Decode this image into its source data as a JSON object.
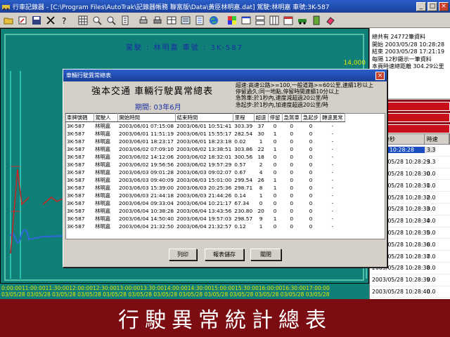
{
  "window": {
    "title": "行車記錄器 - [C:\\Program Files\\AutoTrak\\記錄器帳務 聯富版\\Data\\黃臣林明嘉.dat]   駕駛:林明嘉   車號:3K-587",
    "buttons": [
      "_",
      "□",
      "×"
    ]
  },
  "chart": {
    "header": "駕駛 : 林明嘉     車號 : 3K-587",
    "y_top_label": "14,000",
    "time_rows": [
      "0:00:0011:00:0011:30:0012:00:0012:30:0013:00:0013:30:0014:00:0014:30:0015:00:0015:30:0016:00:0016:30:0017:00:00",
      "03/05/28 03/05/28 03/05/28 03/05/28 03/05/28 03/05/28 03/05/28 03/05/28 03/05/28 03/05/28 03/05/28 03/05/28 03/05/28"
    ]
  },
  "right_panel": {
    "info": [
      "總共有 24772筆資料",
      "開始 2003/05/28 10:28:28",
      "結束 2003/05/28 17:21:19",
      "每隔 12秒顯示一筆資料",
      "本頁時速總距離    304.29公里"
    ],
    "red_buttons": [
      "",
      "速",
      "速"
    ],
    "table_headers": [
      "日時分秒",
      "時速"
    ],
    "rows": [
      {
        "time": "05/28 10:28:28",
        "value": "3.3",
        "selected": true
      },
      {
        "time": "2003/05/28 10:28:29",
        "value": "3.3"
      },
      {
        "time": "2003/05/28 10:28:30",
        "value": "0.0"
      },
      {
        "time": "2003/05/28 10:28:31",
        "value": "0.0"
      },
      {
        "time": "2003/05/28 10:28:32",
        "value": "0.0"
      },
      {
        "time": "2003/05/28 10:28:33",
        "value": "0.0"
      },
      {
        "time": "2003/05/28 10:28:34",
        "value": "0.0"
      },
      {
        "time": "2003/05/28 10:28:35",
        "value": "0.0"
      },
      {
        "time": "2003/05/28 10:28:36",
        "value": "0.0"
      },
      {
        "time": "2003/05/28 10:28:37",
        "value": "0.0"
      },
      {
        "time": "2003/05/28 10:28:38",
        "value": "0.0"
      },
      {
        "time": "2003/05/28 10:28:39",
        "value": "0.0"
      },
      {
        "time": "2003/05/28 10:28:40",
        "value": "0.0"
      },
      {
        "time": "2003/05/28 10:28:41",
        "value": "0.0"
      }
    ]
  },
  "dialog": {
    "title": "車輛行駛異常總表",
    "company": "強本交通  車輛行駛異常總表",
    "period": "期間: 03年6月",
    "rules": [
      "超速:高速公路>=100,一般道路>=60公里,連續1秒以上",
      "停留過久:同一地點,停留時間連續10分以上",
      "急煞車:於1秒內,速度減超過20公里/時",
      "急起步:於1秒內,加速度超過20公里/時"
    ],
    "columns": [
      "車牌號碼",
      "駕駛人",
      "開始時間",
      "結束時間",
      "里程",
      "超速",
      "停留",
      "急煞車",
      "急起步",
      "轉速異常"
    ],
    "rows": [
      [
        "3K-587",
        "林明嘉",
        "2003/06/01 07:15:08",
        "2003/06/01 10:51:41",
        "303.39",
        "37",
        "0",
        "0",
        "0",
        "-"
      ],
      [
        "3K-587",
        "林明嘉",
        "2003/06/01 11:51:19",
        "2003/06/01 15:55:17",
        "282.54",
        "30",
        "1",
        "0",
        "0",
        "-"
      ],
      [
        "3K-587",
        "林明嘉",
        "2003/06/01 18:23:17",
        "2003/06/01 18:23:18",
        "0.02",
        "1",
        "0",
        "0",
        "0",
        "-"
      ],
      [
        "3K-587",
        "林明嘉",
        "2003/06/02 07:09:10",
        "2003/06/02 13:38:51",
        "303.86",
        "22",
        "1",
        "0",
        "0",
        "-"
      ],
      [
        "3K-587",
        "林明嘉",
        "2003/06/02 14:12:06",
        "2003/06/02 18:32:01",
        "300.56",
        "18",
        "0",
        "0",
        "0",
        "-"
      ],
      [
        "3K-587",
        "林明嘉",
        "2003/06/02 19:56:56",
        "2003/06/02 19:57:29",
        "0.57",
        "2",
        "0",
        "0",
        "0",
        "-"
      ],
      [
        "3K-587",
        "林明嘉",
        "2003/06/03 09:01:28",
        "2003/06/03 09:02:07",
        "0.67",
        "4",
        "0",
        "0",
        "0",
        "-"
      ],
      [
        "3K-587",
        "林明嘉",
        "2003/06/03 09:40:09",
        "2003/06/03 15:01:00",
        "299.54",
        "26",
        "1",
        "0",
        "0",
        "-"
      ],
      [
        "3K-587",
        "林明嘉",
        "2003/06/03 15:39:00",
        "2003/06/03 20:25:36",
        "298.71",
        "8",
        "1",
        "0",
        "0",
        "-"
      ],
      [
        "3K-587",
        "林明嘉",
        "2003/06/03 21:44:18",
        "2003/06/03 21:44:26",
        "0.14",
        "1",
        "0",
        "0",
        "0",
        "-"
      ],
      [
        "3K-587",
        "林明嘉",
        "2003/06/04 09:33:04",
        "2003/06/04 10:21:17",
        "67.34",
        "0",
        "0",
        "0",
        "0",
        "-"
      ],
      [
        "3K-587",
        "林明嘉",
        "2003/06/04 10:38:28",
        "2003/06/04 13:43:56",
        "230.80",
        "20",
        "0",
        "0",
        "0",
        "-"
      ],
      [
        "3K-587",
        "林明嘉",
        "2003/06/04 14:50:40",
        "2003/06/04 19:57:03",
        "298.57",
        "9",
        "1",
        "0",
        "0",
        "-"
      ],
      [
        "3K-587",
        "林明嘉",
        "2003/06/04 21:32:50",
        "2003/06/04 21:32:57",
        "0.12",
        "1",
        "0",
        "0",
        "0",
        "-"
      ]
    ],
    "buttons": {
      "print": "列印",
      "save": "報表儲存",
      "close": "關閉"
    }
  },
  "banner": "行駛異常統計總表"
}
